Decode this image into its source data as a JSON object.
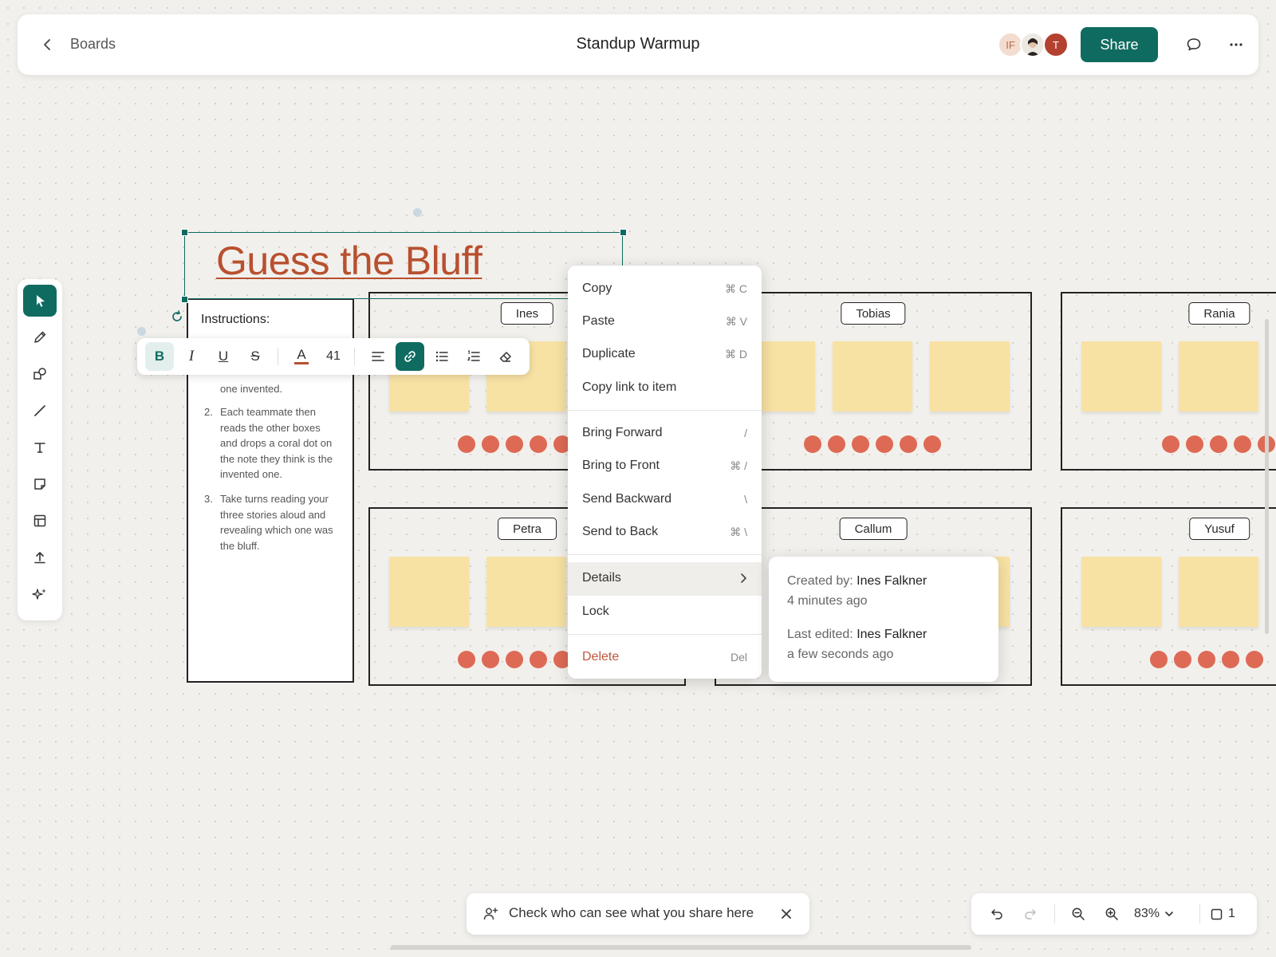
{
  "topbar": {
    "back_label": "Boards",
    "title": "Standup Warmup",
    "avatars": [
      {
        "initials": "IF",
        "bg": "#f3ddd0",
        "fg": "#b86a45"
      },
      {
        "initials": "",
        "bg": "#e8e4de",
        "fg": "#333"
      },
      {
        "initials": "T",
        "bg": "#b4412f",
        "fg": "#ffffff"
      }
    ],
    "share_label": "Share"
  },
  "canvas": {
    "title_text": "Guess the Bluff",
    "instructions": {
      "heading": "Instructions:",
      "item1_tail": "one invented.",
      "item2_num": "2.",
      "item2": "Each teammate then reads the other boxes and drops a coral dot on the note they think is the invented one.",
      "item3_num": "3.",
      "item3": "Take turns reading your three stories aloud and revealing which one was the bluff."
    },
    "players": [
      "Ines",
      "Tobias",
      "Rania",
      "Petra",
      "Callum",
      "Yusuf"
    ]
  },
  "format_toolbar": {
    "bold": "B",
    "italic": "I",
    "underline": "U",
    "strike": "S",
    "font_color_letter": "A",
    "font_size": "41"
  },
  "context_menu": {
    "items": [
      {
        "label": "Copy",
        "shortcut": "⌘ C"
      },
      {
        "label": "Paste",
        "shortcut": "⌘ V"
      },
      {
        "label": "Duplicate",
        "shortcut": "⌘ D"
      },
      {
        "label": "Copy link to item",
        "shortcut": ""
      },
      {
        "label": "Bring Forward",
        "shortcut": "/"
      },
      {
        "label": "Bring to Front",
        "shortcut": "⌘ /"
      },
      {
        "label": "Send Backward",
        "shortcut": "\\"
      },
      {
        "label": "Send to Back",
        "shortcut": "⌘ \\"
      },
      {
        "label": "Details",
        "shortcut": ""
      },
      {
        "label": "Lock",
        "shortcut": ""
      },
      {
        "label": "Delete",
        "shortcut": "Del"
      }
    ]
  },
  "details": {
    "created_label": "Created by:",
    "created_by": "Ines Falkner",
    "created_when": "4 minutes ago",
    "edited_label": "Last edited:",
    "edited_by": "Ines Falkner",
    "edited_when": "a few seconds ago"
  },
  "toast": {
    "text": "Check who can see what you share here"
  },
  "zoom": {
    "level": "83%",
    "pages": "1"
  },
  "colors": {
    "accent": "#0f6b60",
    "title": "#b8502f",
    "sticky": "#f7e2a4",
    "vote_dot": "#de6a55"
  }
}
